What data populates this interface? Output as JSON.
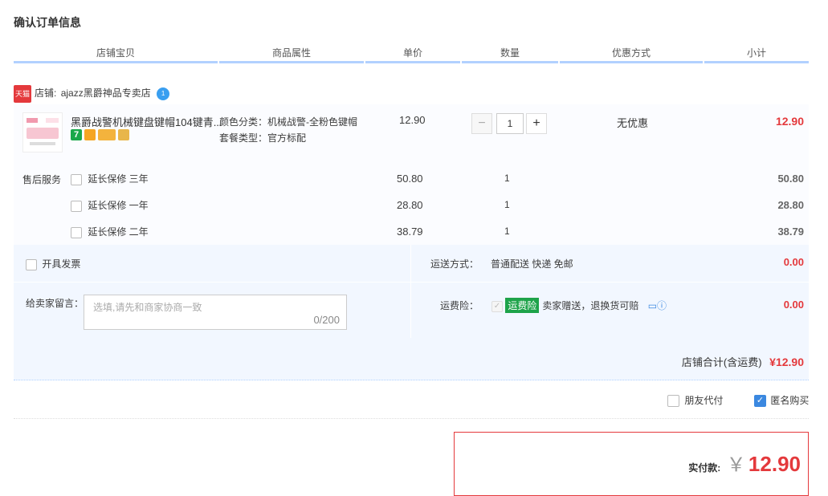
{
  "title": "确认订单信息",
  "columns": [
    "店铺宝贝",
    "商品属性",
    "单价",
    "数量",
    "优惠方式",
    "小计"
  ],
  "shop": {
    "label": "店铺:",
    "name": "ajazz黑爵神品专卖店",
    "badge": "天猫"
  },
  "item": {
    "name": "黑爵战警机械键盘键帽104键青...",
    "attr1": "颜色分类：机械战警-全粉色键帽",
    "attr2": "套餐类型：官方标配",
    "price": "12.90",
    "qty": "1",
    "discount": "无优惠",
    "subtotal": "12.90",
    "icon_colors": [
      "#1aa84a",
      "#f5a623",
      "#f3b33d",
      "#e8b64a"
    ]
  },
  "after_sales": {
    "label": "售后服务",
    "options": [
      {
        "label": "延长保修 三年",
        "price": "50.80",
        "qty": "1",
        "subtotal": "50.80"
      },
      {
        "label": "延长保修 一年",
        "price": "28.80",
        "qty": "1",
        "subtotal": "28.80"
      },
      {
        "label": "延长保修 二年",
        "price": "38.79",
        "qty": "1",
        "subtotal": "38.79"
      }
    ]
  },
  "invoice": {
    "label": "开具发票"
  },
  "shipping": {
    "label": "运送方式：",
    "value": "普通配送 快递 免邮",
    "amount": "0.00"
  },
  "message": {
    "label": "给卖家留言：",
    "placeholder": "选填,请先和商家协商一致",
    "counter": "0/200"
  },
  "insurance": {
    "label": "运费险：",
    "badge": "运费险",
    "text": "卖家赠送，退换货可赔",
    "amount": "0.00"
  },
  "shop_total": {
    "label": "店铺合计(含运费)",
    "value": "¥12.90"
  },
  "options": {
    "friend_pay": "朋友代付",
    "anonymous": "匿名购买"
  },
  "pay": {
    "label": "实付款:",
    "currency": "￥",
    "amount": "12.90"
  }
}
